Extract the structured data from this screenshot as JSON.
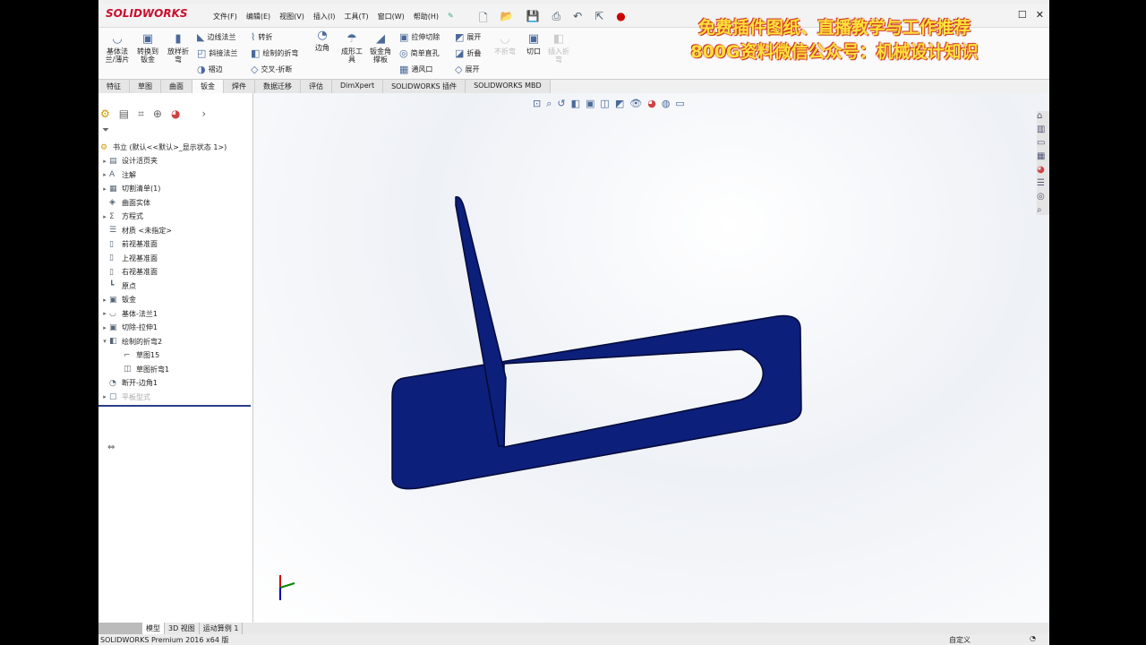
{
  "app": {
    "logo": "SOLIDWORKS",
    "menu": [
      "文件(F)",
      "编辑(E)",
      "视图(V)",
      "插入(I)",
      "工具(T)",
      "窗口(W)",
      "帮助(H)"
    ]
  },
  "ribbon": {
    "big": [
      "基体法兰/薄片",
      "转换到钣金",
      "放样折弯"
    ],
    "col1": [
      "边线法兰",
      "斜接法兰",
      "褶边"
    ],
    "col2": [
      "转折",
      "绘制的折弯",
      "交叉-折断"
    ],
    "corner": "边角",
    "big2": [
      "成形工具",
      "钣金角撑板"
    ],
    "col3": [
      "拉伸切除",
      "简单直孔",
      "通风口"
    ],
    "col4": [
      "展开",
      "折叠",
      "展开"
    ],
    "disabled1": "不折弯",
    "cut": "切口",
    "disabled2": "插入折弯"
  },
  "tabs": [
    "特征",
    "草图",
    "曲面",
    "钣金",
    "焊件",
    "数据迁移",
    "评估",
    "DimXpert",
    "SOLIDWORKS 插件",
    "SOLIDWORKS MBD"
  ],
  "active_tab": "钣金",
  "promo": {
    "line1": "免费插件图纸、直播教学与工作推荐",
    "line2": "800G资料微信公众号：机械设计知识"
  },
  "tree": {
    "root": "书立 (默认<<默认>_显示状态 1>)",
    "items": [
      {
        "label": "设计活页夹",
        "arrow": "▸",
        "icon": "▤"
      },
      {
        "label": "注解",
        "arrow": "▸",
        "icon": "A"
      },
      {
        "label": "切割清单(1)",
        "arrow": "▸",
        "icon": "▦"
      },
      {
        "label": "曲面实体",
        "arrow": "",
        "icon": "◈"
      },
      {
        "label": "方程式",
        "arrow": "▸",
        "icon": "Σ"
      },
      {
        "label": "材质 <未指定>",
        "arrow": "",
        "icon": "☰"
      },
      {
        "label": "前视基准面",
        "arrow": "",
        "icon": "▯"
      },
      {
        "label": "上视基准面",
        "arrow": "",
        "icon": "▯"
      },
      {
        "label": "右视基准面",
        "arrow": "",
        "icon": "▯"
      },
      {
        "label": "原点",
        "arrow": "",
        "icon": "┗"
      },
      {
        "label": "钣金",
        "arrow": "▸",
        "icon": "▣"
      },
      {
        "label": "基体-法兰1",
        "arrow": "▸",
        "icon": "◡"
      },
      {
        "label": "切除-拉伸1",
        "arrow": "▸",
        "icon": "▣"
      },
      {
        "label": "绘制的折弯2",
        "arrow": "▾",
        "icon": "◧"
      },
      {
        "label": "草图15",
        "arrow": "",
        "icon": "⌐",
        "indent": true
      },
      {
        "label": "草图折弯1",
        "arrow": "",
        "icon": "◫",
        "indent": true
      },
      {
        "label": "断开-边角1",
        "arrow": "",
        "icon": "◔"
      },
      {
        "label": "平板型式",
        "arrow": "▸",
        "icon": "▢",
        "disabled": true
      }
    ]
  },
  "bottom_tabs": [
    "模型",
    "3D 视图",
    "运动算例 1"
  ],
  "status": {
    "left": "SOLIDWORKS Premium 2016 x64 版",
    "right": "自定义"
  },
  "colors": {
    "part": "#0c1f7a",
    "accent": "#c8102e"
  }
}
